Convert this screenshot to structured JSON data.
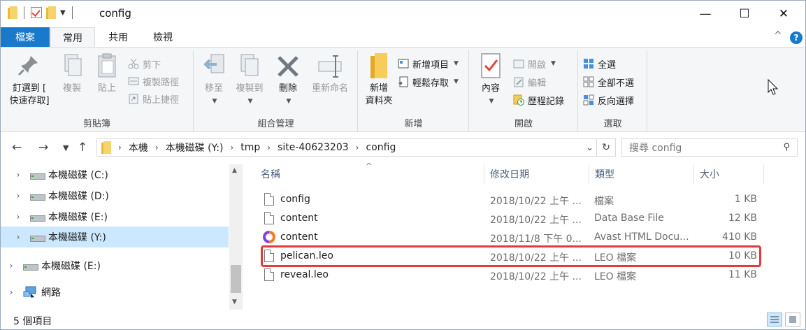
{
  "window": {
    "title": "config",
    "minimize": "—",
    "maximize": "☐",
    "close": "✕"
  },
  "ribbon_tabs": [
    "檔案",
    "常用",
    "共用",
    "檢視"
  ],
  "ribbon_collapse": "^",
  "help": "?",
  "clipboard": {
    "pin_line1": "釘選到 [",
    "pin_line2": "快速存取]",
    "copy": "複製",
    "paste": "貼上",
    "cut": "剪下",
    "copy_path": "複製路徑",
    "paste_shortcut": "貼上捷徑",
    "label": "剪貼簿"
  },
  "organize": {
    "move_to": "移至",
    "copy_to": "複製到",
    "delete": "刪除",
    "rename": "重新命名",
    "label": "組合管理"
  },
  "new": {
    "new_folder_line1": "新增",
    "new_folder_line2": "資料夾",
    "new_item": "新增項目",
    "easy_access": "輕鬆存取",
    "label": "新增"
  },
  "open": {
    "properties": "內容",
    "open": "開啟",
    "edit": "編輯",
    "history": "歷程記錄",
    "label": "開啟"
  },
  "select": {
    "select_all": "全選",
    "select_none": "全部不選",
    "invert": "反向選擇",
    "label": "選取"
  },
  "address": {
    "crumbs": [
      "本機",
      "本機磁碟 (Y:)",
      "tmp",
      "site-40623203",
      "config"
    ],
    "search_placeholder": "搜尋 config"
  },
  "nav_pane": [
    {
      "label": "本機磁碟 (C:)",
      "selected": false
    },
    {
      "label": "本機磁碟 (D:)",
      "selected": false
    },
    {
      "label": "本機磁碟 (E:)",
      "selected": false
    },
    {
      "label": "本機磁碟 (Y:)",
      "selected": true
    },
    {
      "label": "本機磁碟 (E:)",
      "selected": false
    },
    {
      "label": "網路",
      "selected": false
    }
  ],
  "columns": {
    "name": "名稱",
    "date": "修改日期",
    "type": "類型",
    "size": "大小"
  },
  "files": [
    {
      "name": "config",
      "date": "2018/10/22 上午 ...",
      "type": "檔案",
      "size": "1 KB",
      "icon": "file-icon"
    },
    {
      "name": "content",
      "date": "2018/10/22 上午 ...",
      "type": "Data Base File",
      "size": "12 KB",
      "icon": "file-icon"
    },
    {
      "name": "content",
      "date": "2018/11/8 下午 0...",
      "type": "Avast HTML Docu...",
      "size": "410 KB",
      "icon": "avast-html-icon"
    },
    {
      "name": "pelican.leo",
      "date": "2018/10/22 上午 ...",
      "type": "LEO 檔案",
      "size": "10 KB",
      "icon": "file-icon"
    },
    {
      "name": "reveal.leo",
      "date": "2018/10/22 上午 ...",
      "type": "LEO 檔案",
      "size": "11 KB",
      "icon": "file-icon"
    }
  ],
  "status": {
    "item_count": "5 個項目"
  },
  "colors": {
    "accent": "#1979ca",
    "selection": "#cce8ff",
    "highlight": "#e03c3c"
  }
}
